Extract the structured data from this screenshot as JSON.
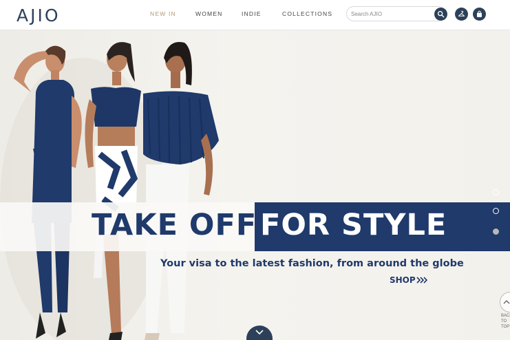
{
  "header": {
    "logo": "AJIO",
    "nav": [
      {
        "label": "NEW IN",
        "active": true
      },
      {
        "label": "WOMEN",
        "active": false
      },
      {
        "label": "INDIE",
        "active": false
      },
      {
        "label": "COLLECTIONS",
        "active": false
      }
    ],
    "search": {
      "placeholder": "Search AJIO",
      "value": ""
    },
    "icons": [
      "search-icon",
      "wishlist-hanger-icon",
      "shopping-bag-icon"
    ]
  },
  "hero": {
    "headline_part1": "TAKE OFF",
    "headline_part2": "FOR STYLE",
    "tagline": "Your visa to the latest fashion, from around the globe",
    "cta": "SHOP",
    "slides": 3,
    "active_slide": 3,
    "back_to_top": "BACK TO TOP"
  },
  "colors": {
    "brand": "#2c4159",
    "banner": "#1f3a6b",
    "nav_active": "#b09a76"
  }
}
